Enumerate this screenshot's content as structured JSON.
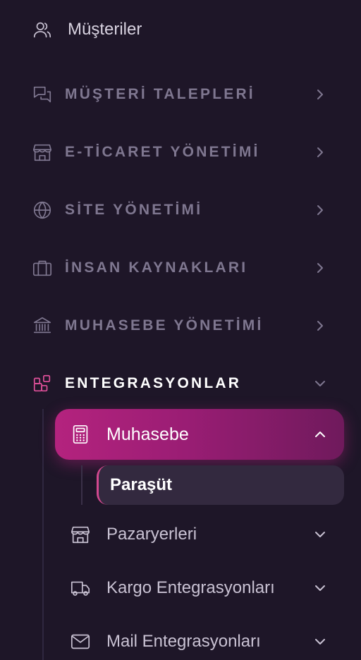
{
  "top_item": {
    "label": "Müşteriler",
    "icon": "users-icon"
  },
  "sections": [
    {
      "label": "MÜŞTERİ TALEPLERİ",
      "icon": "chat-icon"
    },
    {
      "label": "E-TİCARET YÖNETİMİ",
      "icon": "store-icon"
    },
    {
      "label": "SİTE YÖNETİMİ",
      "icon": "globe-icon"
    },
    {
      "label": "İNSAN KAYNAKLARI",
      "icon": "briefcase-icon"
    },
    {
      "label": "MUHASEBE YÖNETİMİ",
      "icon": "bank-icon"
    },
    {
      "label": "ENTEGRASYONLAR",
      "icon": "apps-add-icon"
    }
  ],
  "integrations": {
    "active_item": {
      "label": "Muhasebe",
      "icon": "calculator-icon"
    },
    "active_child": {
      "label": "Paraşüt"
    },
    "items": [
      {
        "label": "Pazaryerleri",
        "icon": "store-icon"
      },
      {
        "label": "Kargo Entegrasyonları",
        "icon": "truck-icon"
      },
      {
        "label": "Mail Entegrasyonları",
        "icon": "mail-icon"
      }
    ]
  },
  "colors": {
    "background": "#1e1628",
    "muted_text": "#7f7790",
    "accent": "#e0509a",
    "active_gradient_start": "#b4237e",
    "active_gradient_end": "#6f1a5c"
  }
}
